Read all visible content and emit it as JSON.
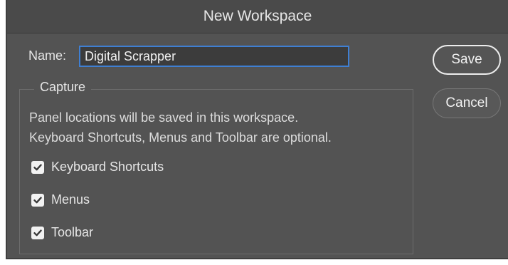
{
  "dialog": {
    "title": "New Workspace"
  },
  "name_field": {
    "label": "Name:",
    "value": "Digital Scrapper"
  },
  "capture": {
    "legend": "Capture",
    "description_line1": "Panel locations will be saved in this workspace.",
    "description_line2": "Keyboard Shortcuts, Menus and Toolbar are optional.",
    "options": [
      {
        "label": "Keyboard Shortcuts",
        "checked": true
      },
      {
        "label": "Menus",
        "checked": true
      },
      {
        "label": "Toolbar",
        "checked": true
      }
    ]
  },
  "buttons": {
    "save": "Save",
    "cancel": "Cancel"
  },
  "colors": {
    "background": "#535353",
    "focus_ring": "#3f7fd2",
    "text": "#e6e6e6"
  }
}
